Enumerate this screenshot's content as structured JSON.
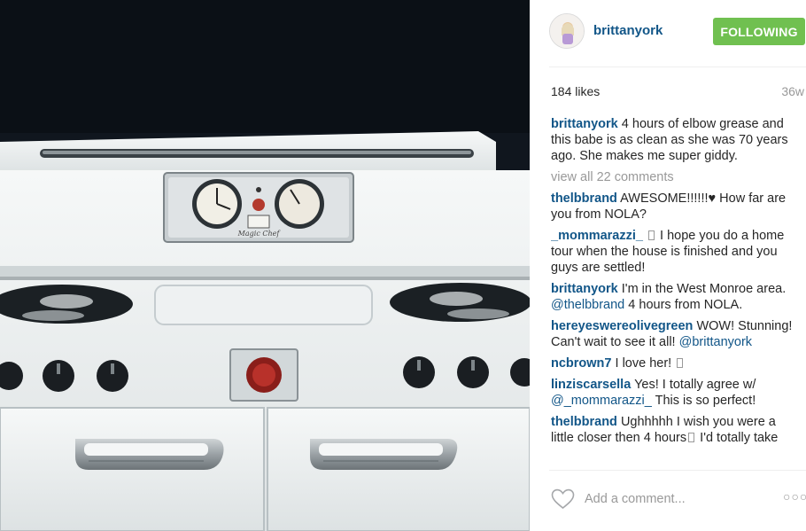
{
  "post": {
    "username": "brittanyork",
    "follow_label": "FOLLOWING",
    "likes": "184 likes",
    "age": "36w",
    "caption": {
      "user": "brittanyork",
      "text": "4 hours of elbow grease and this babe is as clean as she was 70 years ago. She makes me super giddy."
    },
    "view_all": "view all 22 comments",
    "comments": [
      {
        "user": "thelbbrand",
        "text": "AWESOME!!!!!!♥ How far are you from NOLA?"
      },
      {
        "user": "_mommarazzi_",
        "text": "I hope you do a home tour when the house is finished and you guys are settled!"
      },
      {
        "user": "brittanyork",
        "text": "I'm in the West Monroe area.",
        "mention": "@thelbbrand",
        "after": "4 hours from NOLA."
      },
      {
        "user": "hereyeswereolivegreen",
        "text": "WOW! Stunning! Can't wait to see it all!",
        "mention": "@brittanyork"
      },
      {
        "user": "ncbrown7",
        "text": "I love her!"
      },
      {
        "user": "linziscarsella",
        "text": "Yes! I totally agree w/",
        "mention": "@_mommarazzi_",
        "after": "This is so perfect!"
      },
      {
        "user": "thelbbrand",
        "text": "Ughhhhh I wish you were a little closer then 4 hours",
        "after": "I'd totally take"
      }
    ],
    "add_comment_placeholder": "Add a comment...",
    "more_label": "○○○"
  },
  "photo": {
    "stove_brand": "Magic Chef"
  },
  "colors": {
    "link": "#125688",
    "follow_green": "#70c050",
    "muted": "#999999",
    "photo_bg": "#0f141c"
  },
  "icons": [
    "heart-icon",
    "more-options-icon"
  ]
}
